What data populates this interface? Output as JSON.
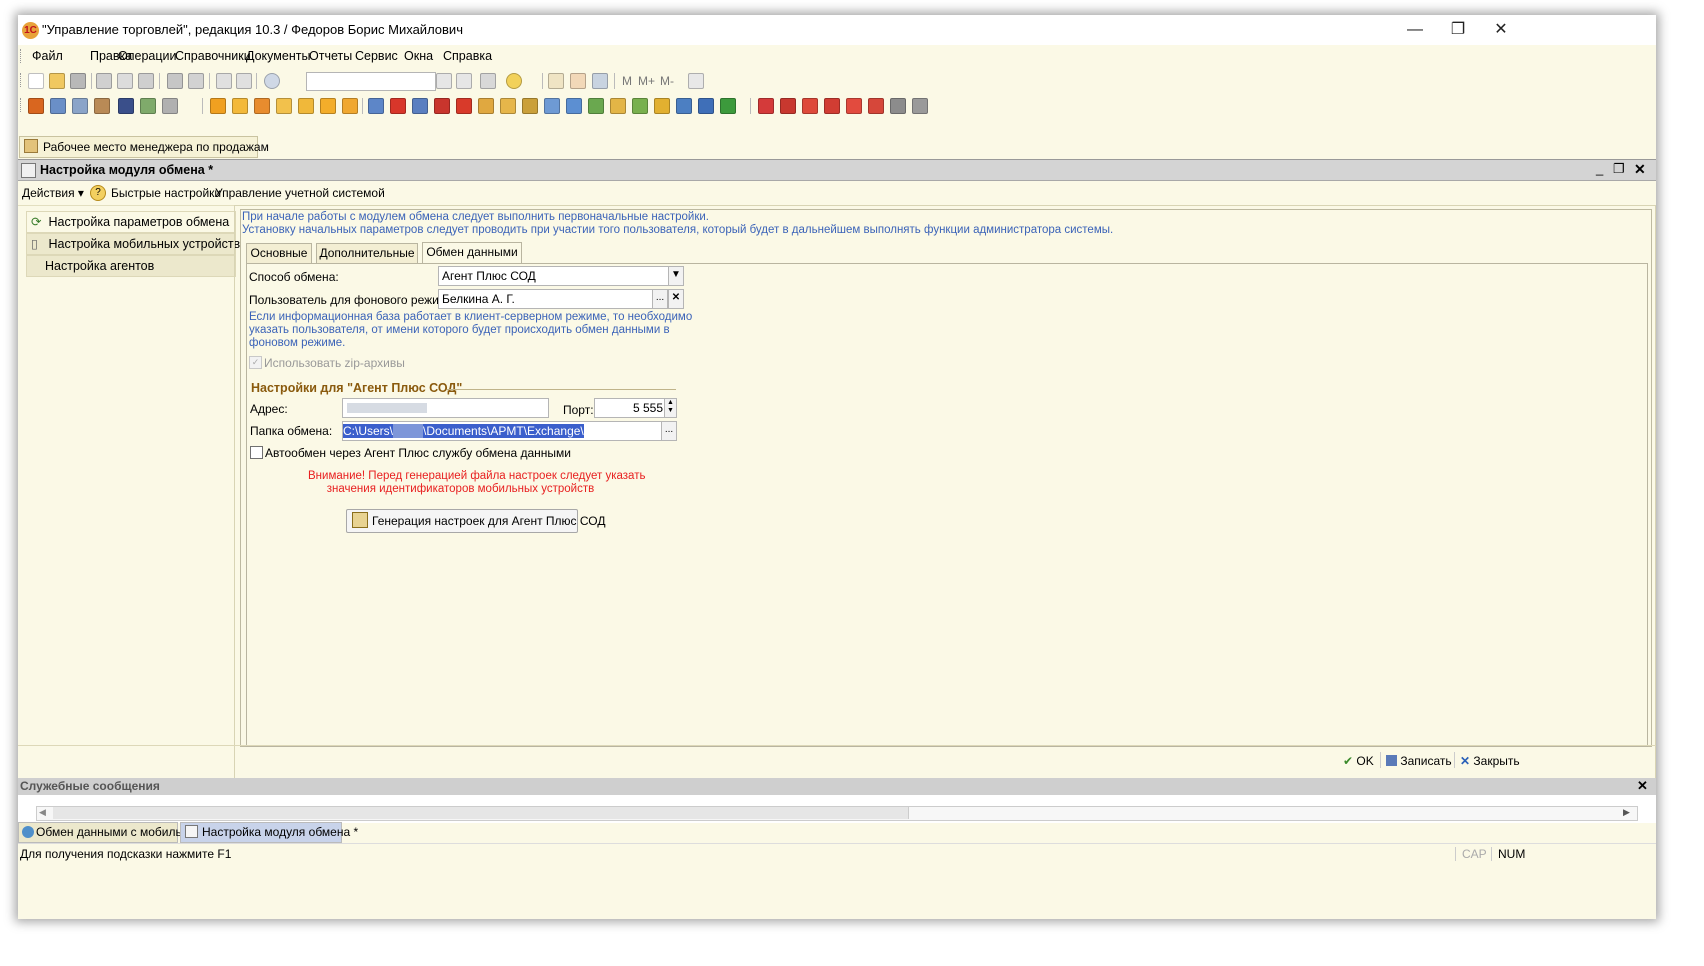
{
  "window": {
    "title": "\"Управление торговлей\", редакция 10.3 / Федоров Борис Михайлович",
    "logo_text": "1С",
    "minimize": "—",
    "restore": "❐",
    "close": "✕"
  },
  "menu": [
    "Файл",
    "Правка",
    "Операции",
    "Справочники",
    "Документы",
    "Отчеты",
    "Сервис",
    "Окна",
    "Справка"
  ],
  "toolbar": {
    "text_buttons": [
      "M",
      "M+",
      "M-"
    ]
  },
  "panel_button": "Рабочее место менеджера по продажам",
  "document": {
    "title": "Настройка модуля обмена *",
    "actions": [
      "Действия ▾",
      "Быстрые настройки",
      "Управление учетной системой"
    ],
    "sidebar": [
      "Настройка параметров обмена",
      "Настройка мобильных устройств",
      "Настройка агентов"
    ],
    "hint_line1": "При начале работы с модулем обмена следует выполнить первоначальные настройки.",
    "hint_line2": "Установку начальных параметров следует проводить при участии того пользователя, который будет в дальнейшем выполнять функции администратора системы.",
    "tabs": [
      "Основные",
      "Дополнительные",
      "Обмен данными"
    ],
    "active_tab": "Обмен данными",
    "exchange_method_label": "Способ обмена:",
    "exchange_method_value": "Агент Плюс СОД",
    "bg_user_label": "Пользователь для фонового режима:",
    "bg_user_value": "Белкина А. Г.",
    "bg_hint_1": "Если информационная база работает в клиент-серверном режиме, то необходимо",
    "bg_hint_2": "указать пользователя, от имени которого будет происходить обмен данными в",
    "bg_hint_3": "фоновом режиме.",
    "use_zip_label": "Использовать zip-архивы",
    "group_title": "Настройки для \"Агент Плюс СОД\"",
    "address_label": "Адрес:",
    "port_label": "Порт:",
    "port_value": "5 555",
    "folder_label": "Папка обмена:",
    "folder_value_start": "C:\\Users\\",
    "folder_value_end": "\\Documents\\APMT\\Exchange\\",
    "autoexchange_label": "Автообмен через Агент Плюс службу обмена данными",
    "warning_1": "Внимание! Перед генерацией файла настроек следует указать",
    "warning_2": "значения идентификаторов мобильных устройств",
    "generate_button": "Генерация настроек для Агент Плюс СОД",
    "ok": "OK",
    "save": "Записать",
    "close": "Закрыть"
  },
  "service_messages": "Служебные сообщения",
  "taskbar": [
    "Обмен данными с мобильн...",
    "Настройка модуля обмена *"
  ],
  "status": {
    "hint": "Для получения подсказки нажмите F1",
    "cap": "CAP",
    "num": "NUM"
  }
}
